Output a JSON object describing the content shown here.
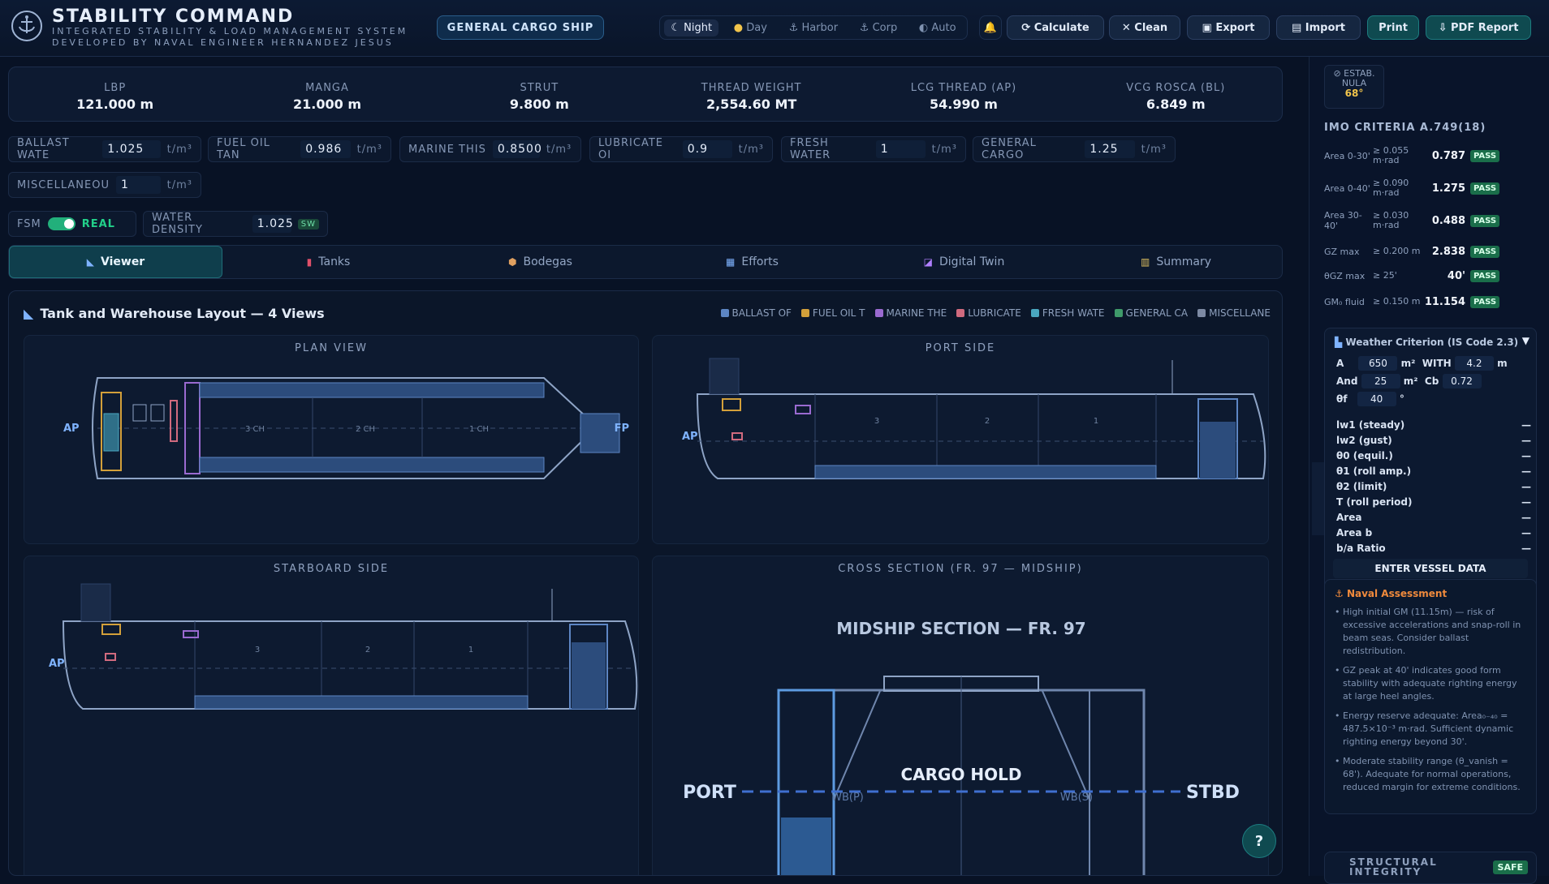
{
  "app": {
    "title": "STABILITY COMMAND",
    "subtitle1": "INTEGRATED STABILITY & LOAD MANAGEMENT SYSTEM",
    "subtitle2": "DEVELOPED BY NAVAL ENGINEER HERNANDEZ JESUS",
    "vessel_type": "GENERAL CARGO SHIP"
  },
  "modes": [
    "Night",
    "Day",
    "Harbor",
    "Corp",
    "Auto"
  ],
  "toolbar": {
    "calculate": "Calculate",
    "clean": "Clean",
    "export": "Export",
    "import": "Import",
    "print": "Print",
    "pdf": "PDF Report"
  },
  "kpis": [
    {
      "label": "LBP",
      "value": "121.000 m"
    },
    {
      "label": "MANGA",
      "value": "21.000 m"
    },
    {
      "label": "STRUT",
      "value": "9.800 m"
    },
    {
      "label": "THREAD WEIGHT",
      "value": "2,554.60 MT"
    },
    {
      "label": "LCG THREAD (AP)",
      "value": "54.990 m"
    },
    {
      "label": "VCG ROSCA (BL)",
      "value": "6.849 m"
    }
  ],
  "densities": [
    {
      "label": "BALLAST WATE",
      "value": "1.025",
      "unit": "t/m³"
    },
    {
      "label": "FUEL OIL TAN",
      "value": "0.986",
      "unit": "t/m³"
    },
    {
      "label": "MARINE THIS",
      "value": "0.8500",
      "unit": "t/m³"
    },
    {
      "label": "LUBRICATE OI",
      "value": "0.9",
      "unit": "t/m³"
    },
    {
      "label": "FRESH WATER",
      "value": "1",
      "unit": "t/m³"
    },
    {
      "label": "GENERAL CARGO",
      "value": "1.25",
      "unit": "t/m³"
    },
    {
      "label": "MISCELLANEOU",
      "value": "1",
      "unit": "t/m³"
    }
  ],
  "fsm": {
    "label": "FSM",
    "state": "REAL",
    "wd_label": "WATER DENSITY",
    "wd_value": "1.025",
    "wd_tag": "SW"
  },
  "tabs": [
    "Viewer",
    "Tanks",
    "Bodegas",
    "Efforts",
    "Digital Twin",
    "Summary"
  ],
  "panel": {
    "title": "Tank and Warehouse Layout — 4 Views",
    "legend": [
      {
        "name": "BALLAST OF",
        "color": "#5d86c4"
      },
      {
        "name": "FUEL OIL T",
        "color": "#d3a03a"
      },
      {
        "name": "MARINE THE",
        "color": "#9a6ad0"
      },
      {
        "name": "LUBRICATE",
        "color": "#d06a7e"
      },
      {
        "name": "FRESH WATE",
        "color": "#4aa7c0"
      },
      {
        "name": "GENERAL CA",
        "color": "#3f9a6a"
      },
      {
        "name": "MISCELLANE",
        "color": "#7d8aa3"
      }
    ]
  },
  "views": {
    "plan": "PLAN VIEW",
    "port": "PORT SIDE",
    "stbd": "STARBOARD SIDE",
    "cross": "CROSS SECTION (FR. 97 — MIDSHIP)"
  },
  "draw": {
    "ap": "AP",
    "fp": "FP",
    "holds": [
      "3 CH",
      "2 CH",
      "1 CH"
    ],
    "nums": [
      "3",
      "2",
      "1"
    ],
    "mid_title": "MIDSHIP SECTION — FR. 97",
    "cargo": "CARGO HOLD",
    "port": "PORT",
    "stbd": "STBD",
    "wbp": "WB(P)",
    "wbs": "WB(S)"
  },
  "side": {
    "est_label": "ESTAB. NULA",
    "est_val": "68°",
    "imo_title": "IMO CRITERIA A.749(18)",
    "imo": [
      {
        "name": "Area 0-30'",
        "crit": "≥ 0.055 m·rad",
        "val": "0.787",
        "st": "PASS"
      },
      {
        "name": "Area 0-40'",
        "crit": "≥ 0.090 m·rad",
        "val": "1.275",
        "st": "PASS"
      },
      {
        "name": "Area 30-40'",
        "crit": "≥ 0.030 m·rad",
        "val": "0.488",
        "st": "PASS"
      },
      {
        "name": "GZ max",
        "crit": "≥ 0.200 m",
        "val": "2.838",
        "st": "PASS"
      },
      {
        "name": "θGZ max",
        "crit": "≥ 25'",
        "val": "40'",
        "st": "PASS"
      },
      {
        "name": "GM₀ fluid",
        "crit": "≥ 0.150 m",
        "val": "11.154",
        "st": "PASS"
      }
    ],
    "weather_title": "Weather Criterion (IS Code 2.3)",
    "w_inputs": {
      "a_label": "A",
      "a_val": "650",
      "a_unit": "m²",
      "with_label": "WITH",
      "with_val": "4.2",
      "with_unit": "m",
      "and_label": "And",
      "and_val": "25",
      "and_unit": "m²",
      "cb_label": "Cb",
      "cb_val": "0.72",
      "th_label": "θf",
      "th_val": "40",
      "th_unit": "°"
    },
    "w_rows": [
      "lw1 (steady)",
      "lw2 (gust)",
      "θ0 (equil.)",
      "θ1 (roll amp.)",
      "θ2 (limit)",
      "T (roll period)",
      "Area",
      "Area b",
      "b/a Ratio"
    ],
    "w_dash": "—",
    "enter": "ENTER VESSEL DATA",
    "naval_title": "Naval Assessment",
    "notes": [
      "High initial GM (11.15m) — risk of excessive accelerations and snap-roll in beam seas. Consider ballast redistribution.",
      "GZ peak at 40' indicates good form stability with adequate righting energy at large heel angles.",
      "Energy reserve adequate: Area₀₋₄₀ = 487.5×10⁻³ m·rad. Sufficient dynamic righting energy beyond 30'.",
      "Moderate stability range (θ_vanish = 68'). Adequate for normal operations, reduced margin for extreme conditions."
    ],
    "struct": "STRUCTURAL INTEGRITY",
    "safe": "SAFE"
  },
  "help": "?"
}
